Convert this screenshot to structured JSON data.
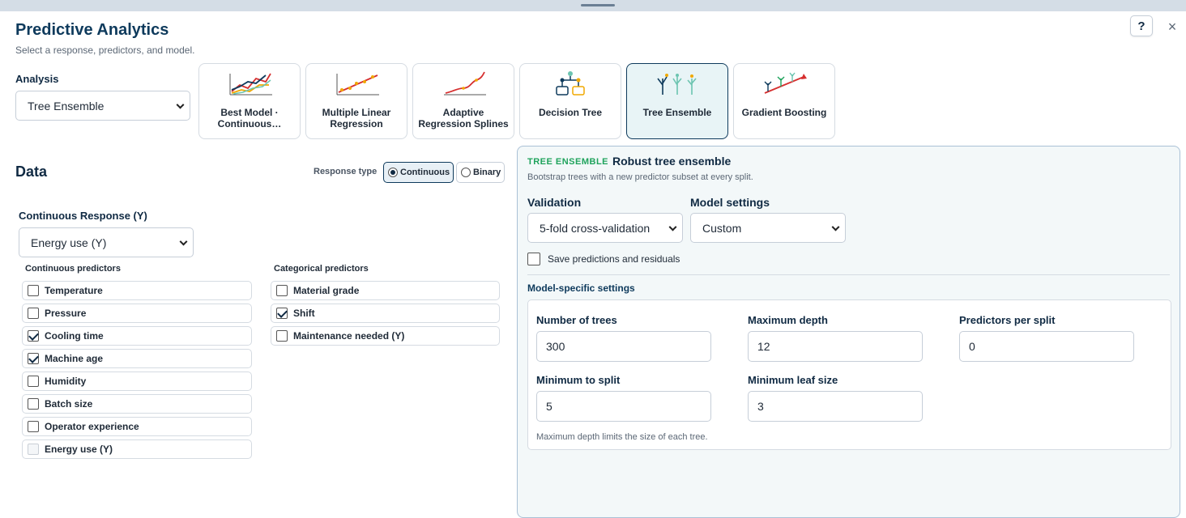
{
  "header": {
    "title": "Predictive Analytics",
    "subtitle": "Select a response, predictors, and model.",
    "help_label": "?",
    "close_label": "×"
  },
  "analysis": {
    "label": "Analysis",
    "selected": "Tree Ensemble"
  },
  "models": [
    {
      "label": "Best Model · Continuous…",
      "icon": "multi-line-chart-icon",
      "active": false
    },
    {
      "label": "Multiple Linear Regression",
      "icon": "linear-regression-icon",
      "active": false
    },
    {
      "label": "Adaptive Regression Splines",
      "icon": "spline-curve-icon",
      "active": false
    },
    {
      "label": "Decision Tree",
      "icon": "decision-tree-icon",
      "active": false
    },
    {
      "label": "Tree Ensemble",
      "icon": "tree-ensemble-icon",
      "active": true
    },
    {
      "label": "Gradient Boosting",
      "icon": "gradient-boosting-icon",
      "active": false
    }
  ],
  "data": {
    "title": "Data",
    "response_type_label": "Response type",
    "response_types": [
      {
        "label": "Continuous",
        "selected": true
      },
      {
        "label": "Binary",
        "selected": false
      }
    ],
    "continuous_response_label": "Continuous Response (Y)",
    "continuous_response_value": "Energy use (Y)",
    "continuous_predictors_label": "Continuous predictors",
    "continuous_predictors": [
      {
        "label": "Temperature",
        "checked": false,
        "disabled": false
      },
      {
        "label": "Pressure",
        "checked": false,
        "disabled": false
      },
      {
        "label": "Cooling time",
        "checked": true,
        "disabled": false
      },
      {
        "label": "Machine age",
        "checked": true,
        "disabled": false
      },
      {
        "label": "Humidity",
        "checked": false,
        "disabled": false
      },
      {
        "label": "Batch size",
        "checked": false,
        "disabled": false
      },
      {
        "label": "Operator experience",
        "checked": false,
        "disabled": false
      },
      {
        "label": "Energy use (Y)",
        "checked": false,
        "disabled": true
      }
    ],
    "categorical_predictors_label": "Categorical predictors",
    "categorical_predictors": [
      {
        "label": "Material grade",
        "checked": false
      },
      {
        "label": "Shift",
        "checked": true
      },
      {
        "label": "Maintenance needed (Y)",
        "checked": false
      }
    ]
  },
  "panel": {
    "kicker": "TREE ENSEMBLE",
    "name": "Robust tree ensemble",
    "description": "Bootstrap trees with a new predictor subset at every split.",
    "validation_label": "Validation",
    "validation_value": "5-fold cross-validation",
    "model_settings_label": "Model settings",
    "model_settings_value": "Custom",
    "save_label": "Save predictions and residuals",
    "save_checked": false,
    "specific_label": "Model-specific settings",
    "fields": {
      "trees_label": "Number of trees",
      "trees_value": "300",
      "depth_label": "Maximum depth",
      "depth_value": "12",
      "pps_label": "Predictors per split",
      "pps_value": "0",
      "minsplit_label": "Minimum to split",
      "minsplit_value": "5",
      "minleaf_label": "Minimum leaf size",
      "minleaf_value": "3"
    },
    "note": "Maximum depth limits the size of each tree."
  }
}
